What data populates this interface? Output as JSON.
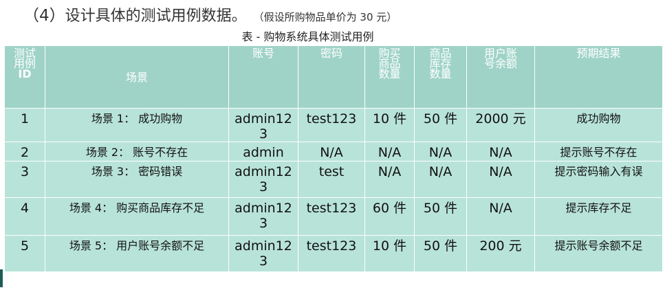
{
  "heading": {
    "number": "（4）",
    "title": "设计具体的测试用例数据。",
    "note": "（假设所购物品单价为 30 元）"
  },
  "caption": "表 - 购物系统具体测试用例",
  "table": {
    "headers": {
      "id_line1": "测试",
      "id_line2": "用例",
      "id_line3": "ID",
      "scene": "场景",
      "account": "账号",
      "password": "密码",
      "qty_line1": "购买",
      "qty_line2": "商品",
      "qty_line3": "数量",
      "stock_line1": "商品",
      "stock_line2": "库存",
      "stock_line3": "数量",
      "balance_line1": "用户账",
      "balance_line2": "号余额",
      "expected": "预期结果"
    },
    "rows": [
      {
        "id": "1",
        "scene": "场景 1： 成功购物",
        "account": "admin123",
        "password": "test123",
        "qty": "10 件",
        "stock": "50 件",
        "balance": "2000 元",
        "expected": "成功购物"
      },
      {
        "id": "2",
        "scene": "场景 2： 账号不存在",
        "account": "admin",
        "password": "N/A",
        "qty": "N/A",
        "stock": "N/A",
        "balance": "N/A",
        "expected": "提示账号不存在"
      },
      {
        "id": "3",
        "scene": "场景 3： 密码错误",
        "account": "admin123",
        "password": "test",
        "qty": "N/A",
        "stock": "N/A",
        "balance": "N/A",
        "expected": "提示密码输入有误"
      },
      {
        "id": "4",
        "scene": "场景 4： 购买商品库存不足",
        "account": "admin123",
        "password": "test123",
        "qty": "60 件",
        "stock": "50 件",
        "balance": "N/A",
        "expected": "提示库存不足"
      },
      {
        "id": "5",
        "scene": "场景 5： 用户账号余额不足",
        "account": "admin123",
        "password": "test123",
        "qty": "10 件",
        "stock": "50 件",
        "balance": "200 元",
        "expected": "提示账号余额不足"
      }
    ]
  },
  "colors": {
    "header_bg": "#9fd3c7",
    "cell_bg": "#b8e3d8",
    "accent_bar": "#1f5c55"
  }
}
